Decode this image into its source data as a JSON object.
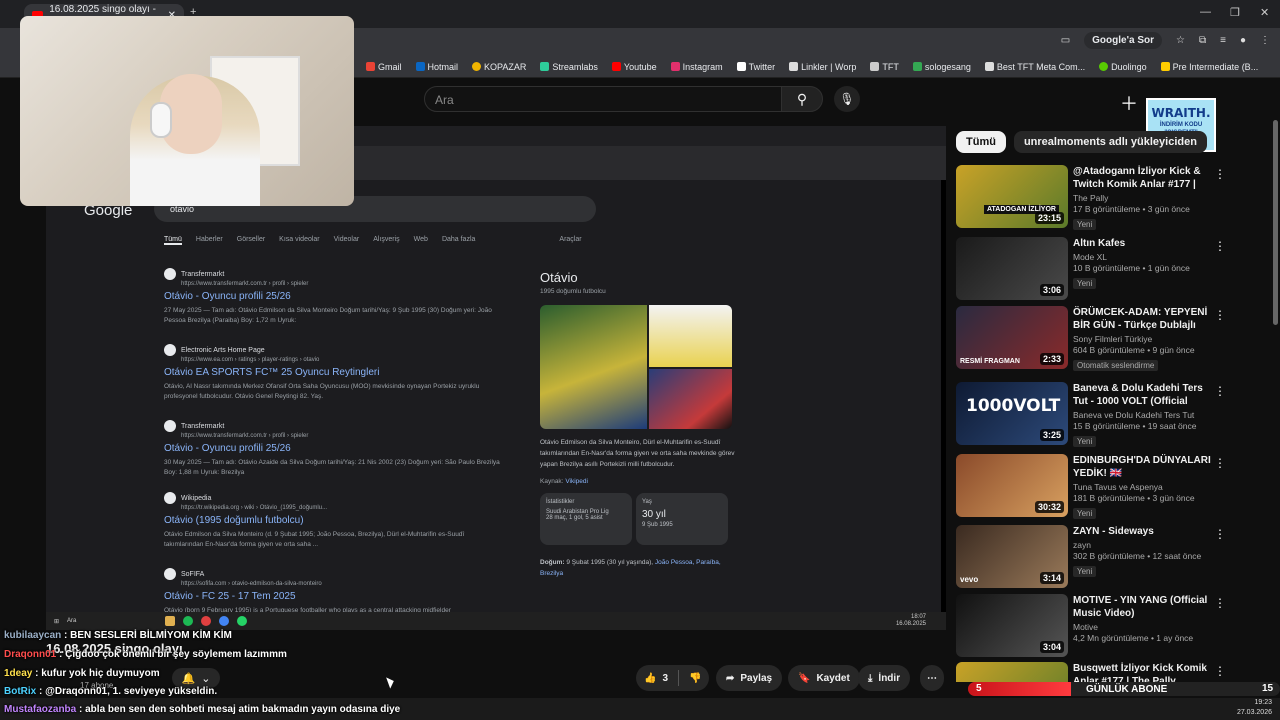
{
  "browser": {
    "tab_title": "16.08.2025 singo olayı - Yo",
    "addr_actions": [
      "Google'a Sor"
    ],
    "bookmarks": [
      "Gmail",
      "Hotmail",
      "KOPAZAR",
      "Streamlabs",
      "Youtube",
      "Instagram",
      "Twitter",
      "Linkler | Worp",
      "TFT",
      "sologesang",
      "Best TFT Meta Com...",
      "Duolingo",
      "Pre Intermediate (B..."
    ],
    "bookmark_colors": [
      "#ea4335",
      "#0a66c2",
      "#f0b400",
      "#2ecc9a",
      "#ff0000",
      "#e1306c",
      "#ffffff",
      "#dddddd",
      "#cccccc",
      "#34a853",
      "#dddddd",
      "#58cc02",
      "#ffcc00"
    ]
  },
  "youtube": {
    "search_placeholder": "Ara",
    "create_label": "Oluştur"
  },
  "video": {
    "title": "16.08.2025 singo olayı",
    "subs": "17 abone",
    "likes": "3",
    "share_label": "Paylaş",
    "save_label": "Kaydet",
    "download_label": "İndir"
  },
  "google": {
    "query": "otavio",
    "logo": "Google",
    "tabs": [
      "Tümü",
      "Haberler",
      "Görseller",
      "Kısa videolar",
      "Videolar",
      "Alışveriş",
      "Web",
      "Daha fazla"
    ],
    "tools": "Araçlar",
    "results": [
      {
        "site": "Transfermarkt",
        "url": "https://www.transfermarkt.com.tr › profil › spieler",
        "title": "Otávio - Oyuncu profili 25/26",
        "snippet": "27 May 2025 — Tam adı: Otávio Edmilson da Silva Monteiro Doğum tarihi/Yaş: 9 Şub 1995 (30) Doğum yeri: João Pessoa Brezilya (Paraiba) Boy: 1,72 m Uyruk:"
      },
      {
        "site": "Electronic Arts Home Page",
        "url": "https://www.ea.com › ratings › player-ratings › otavio",
        "title": "Otávio EA SPORTS FC™ 25 Oyuncu Reytingleri",
        "snippet": "Otávio, Al Nassr takımında Merkez Ofansif Orta Saha Oyuncusu (MOO) mevkisinde oynayan Portekiz uyruklu profesyonel futbolcudur. Otávio Genel Reytingi 82. Yaş."
      },
      {
        "site": "Transfermarkt",
        "url": "https://www.transfermarkt.com.tr › profil › spieler",
        "title": "Otávio - Oyuncu profili 25/26",
        "snippet": "30 May 2025 — Tam adı: Otávio Azaide da Silva Doğum tarihi/Yaş: 21 Nis 2002 (23) Doğum yeri: São Paulo Brezilya Boy: 1,88 m Uyruk: Brezilya"
      },
      {
        "site": "Wikipedia",
        "url": "https://tr.wikipedia.org › wiki › Otávio_(1995_doğumlu...",
        "title": "Otávio (1995 doğumlu futbolcu)",
        "snippet": "Otávio Edmilson da Silva Monteiro (d. 9 Şubat 1995; João Pessoa, Brezilya), Dürl el-Muhtarifin es-Suudî takımlarından En-Nasr'da forma giyen ve orta saha ..."
      },
      {
        "site": "SoFIFA",
        "url": "https://sofifa.com › otavio-edmilson-da-silva-monteiro",
        "title": "Otávio - FC 25 - 17 Tem 2025",
        "snippet": "Otávio (born 9 February 1995) is a Portuguese footballer who plays as a central attacking midfielder"
      }
    ],
    "panel": {
      "title": "Otávio",
      "subtitle": "1995 doğumlu futbolcu",
      "description": "Otávio Edmilson da Silva Monteiro, Dürl el-Muhtarifin es-Suudî takımlarından En-Nasr'da forma giyen ve orta saha mevkinde görev yapan Brezilya asıllı Portekizli milli futbolcudur.",
      "source_label": "Kaynak:",
      "source": "Vikipedi",
      "stats_title": "İstatistikler",
      "stats_line1": "Suudi Arabistan Pro Lig",
      "stats_line2": "28 maç, 1 gol, 5 asist",
      "age_title": "Yaş",
      "age_value": "30 yıl",
      "age_date": "9 Şub 1995",
      "born_label": "Doğum:",
      "born_text": "9 Şubat 1995 (30 yıl yaşında),",
      "born_place": "João Pessoa, Paraíba, Brezilya"
    },
    "taskbar_search": "Ara",
    "clock": "18:07",
    "date": "16.08.2025"
  },
  "sidebar": {
    "chips": [
      "Tümü",
      "unrealmoments adlı yükleyiciden"
    ],
    "items": [
      {
        "title": "@Atadogann İzliyor Kick & Twitch Komik Anlar #177 | The...",
        "channel": "The Pally",
        "meta": "17 B görüntüleme • 3 gün önce",
        "badge": "Yeni",
        "duration": "23:15",
        "thumb": "#c9a227"
      },
      {
        "title": "Altın Kafes",
        "channel": "Mode XL",
        "meta": "10 B görüntüleme • 1 gün önce",
        "badge": "Yeni",
        "duration": "3:06",
        "thumb": "#3a3a3a"
      },
      {
        "title": "ÖRÜMCEK-ADAM: YEPYENİ BİR GÜN - Türkçe Dublajlı Resmi ...",
        "channel": "Sony Filmleri Türkiye",
        "meta": "604 B görüntüleme • 9 gün önce",
        "badge": "Otomatik seslendirme",
        "duration": "2:33",
        "thumb": "#5a1f1f"
      },
      {
        "title": "Baneva & Dolu Kadehi Ters Tut - 1000 VOLT (Official Video)",
        "channel": "Baneva ve Dolu Kadehi Ters Tut",
        "meta": "15 B görüntüleme • 19 saat önce",
        "badge": "Yeni",
        "duration": "3:25",
        "thumb": "#1d2b4a"
      },
      {
        "title": "EDINBURGH'DA DÜNYALARI YEDİK! 🇬🇧",
        "channel": "Tuna Tavus ve Aspenya",
        "meta": "181 B görüntüleme • 3 gün önce",
        "badge": "Yeni",
        "duration": "30:32",
        "thumb": "#8a4a2a"
      },
      {
        "title": "ZAYN - Sideways",
        "channel": "zayn",
        "meta": "302 B görüntüleme • 12 saat önce",
        "badge": "Yeni",
        "duration": "3:14",
        "thumb": "#6b4f3a"
      },
      {
        "title": "MOTIVE - YIN YANG (Official Music Video)",
        "channel": "Motive",
        "meta": "4,2 Mn görüntüleme • 1 ay önce",
        "badge": "",
        "duration": "3:04",
        "thumb": "#2b2b2b"
      },
      {
        "title": "Busqwett İzliyor Kick Komik Anlar #177 | The Pally",
        "channel": "",
        "meta": "",
        "badge": "",
        "duration": "",
        "thumb": "#c9a227"
      }
    ],
    "vevo": "vevo",
    "thumb_text_1": "ATADOGAN İZLİYOR",
    "thumb_text_3": "RESMİ FRAGMAN",
    "thumb_text_4": "1000VOLT"
  },
  "sponsor": {
    "brand": "WRAITH.",
    "line1": "İNDİRİM KODU",
    "line2": "\"CIGDEMT\""
  },
  "chat": [
    {
      "user": "kubilaaycan",
      "msg": "BEN SESLERİ BİLMİYOM KİM KİM",
      "color": "#9bb0c8"
    },
    {
      "user": "Draqonn01",
      "msg": "Çiğdoo çok önemli bir şey söylemem lazımmm",
      "color": "#ff4d4d"
    },
    {
      "user": "1deay",
      "msg": "kufur yok hiç duymuyom",
      "color": "#ffe14d"
    },
    {
      "user": "BotRix",
      "msg": "@Draqonn01, 1. seviyeye yükseldin.",
      "color": "#4dd2ff"
    },
    {
      "user": "Mustafaozanba",
      "msg": "abla ben sen den sohbeti mesaj atim bakmadın yayın odasına diye",
      "color": "#c084fc"
    }
  ],
  "subgoal": {
    "label": "GÜNLÜK ABONE",
    "current": 5,
    "target": 15,
    "progress": 0.33
  },
  "system": {
    "clock": "19:23",
    "date": "27.03.2026"
  }
}
